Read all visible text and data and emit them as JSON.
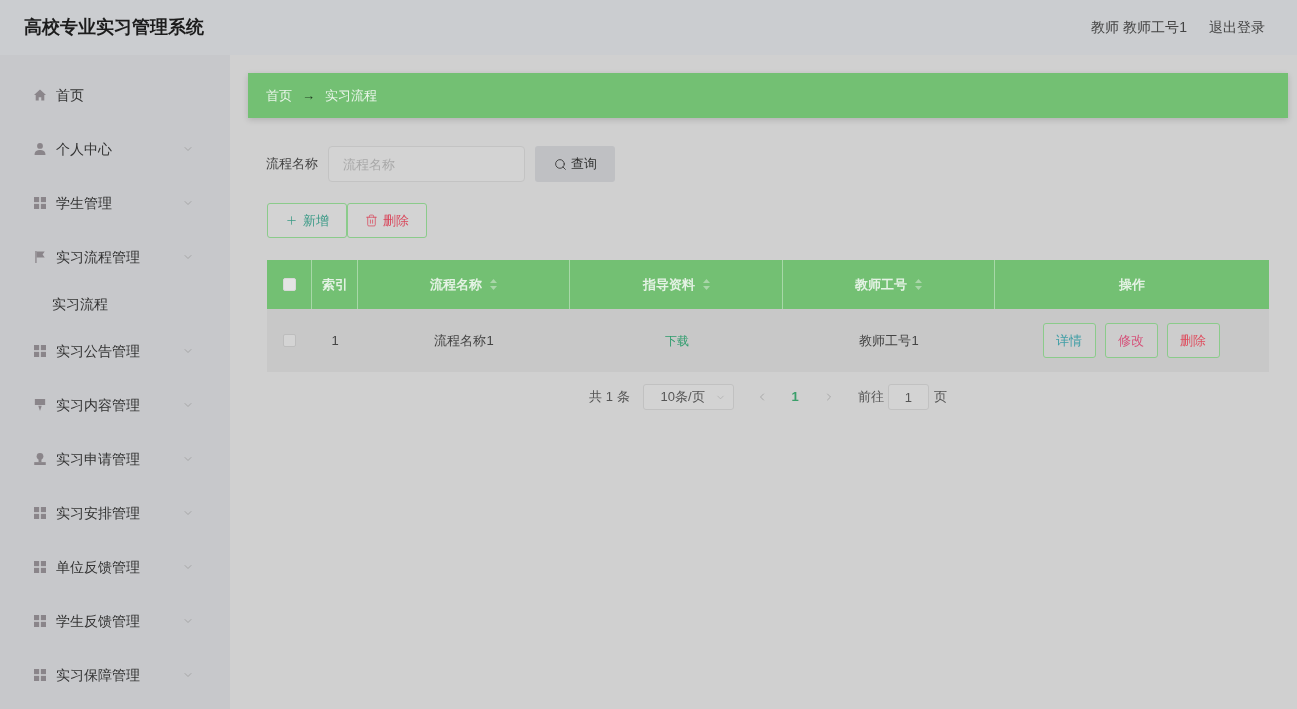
{
  "header": {
    "title": "高校专业实习管理系统",
    "user": "教师 教师工号1",
    "logout": "退出登录"
  },
  "sidebar": {
    "items": [
      {
        "label": "首页",
        "kind": "link"
      },
      {
        "label": "个人中心",
        "kind": "submenu"
      },
      {
        "label": "学生管理",
        "kind": "submenu"
      },
      {
        "label": "实习流程管理",
        "kind": "submenu",
        "children": [
          {
            "label": "实习流程"
          }
        ]
      },
      {
        "label": "实习公告管理",
        "kind": "submenu"
      },
      {
        "label": "实习内容管理",
        "kind": "submenu"
      },
      {
        "label": "实习申请管理",
        "kind": "submenu"
      },
      {
        "label": "实习安排管理",
        "kind": "submenu"
      },
      {
        "label": "单位反馈管理",
        "kind": "submenu"
      },
      {
        "label": "学生反馈管理",
        "kind": "submenu"
      },
      {
        "label": "实习保障管理",
        "kind": "submenu"
      }
    ]
  },
  "breadcrumb": {
    "items": [
      "首页",
      "实习流程"
    ],
    "separator": "→"
  },
  "search": {
    "label": "流程名称",
    "placeholder": "流程名称",
    "button": "查询"
  },
  "toolbar": [
    {
      "label": "新增",
      "kind": "add"
    },
    {
      "label": "删除",
      "kind": "delete"
    }
  ],
  "table": {
    "select_all": {
      "checked": false
    },
    "columns": [
      {
        "label": "索引",
        "sortable": false
      },
      {
        "label": "流程名称",
        "sortable": true
      },
      {
        "label": "指导资料",
        "sortable": true
      },
      {
        "label": "教师工号",
        "sortable": true
      },
      {
        "label": "操作",
        "sortable": false
      }
    ],
    "rows": [
      {
        "checked": false,
        "index": "1",
        "name": "流程名称1",
        "material": "下载",
        "teacher_id": "教师工号1",
        "actions": [
          {
            "label": "详情",
            "kind": "info"
          },
          {
            "label": "修改",
            "kind": "edit"
          },
          {
            "label": "删除",
            "kind": "delete"
          }
        ]
      }
    ]
  },
  "pagination": {
    "total": "共 1 条",
    "page_size": "10条/页",
    "pages": [
      {
        "label": "1",
        "selected": true
      }
    ],
    "goto_label": "前往",
    "goto_value": "1",
    "goto_suffix": "页"
  }
}
